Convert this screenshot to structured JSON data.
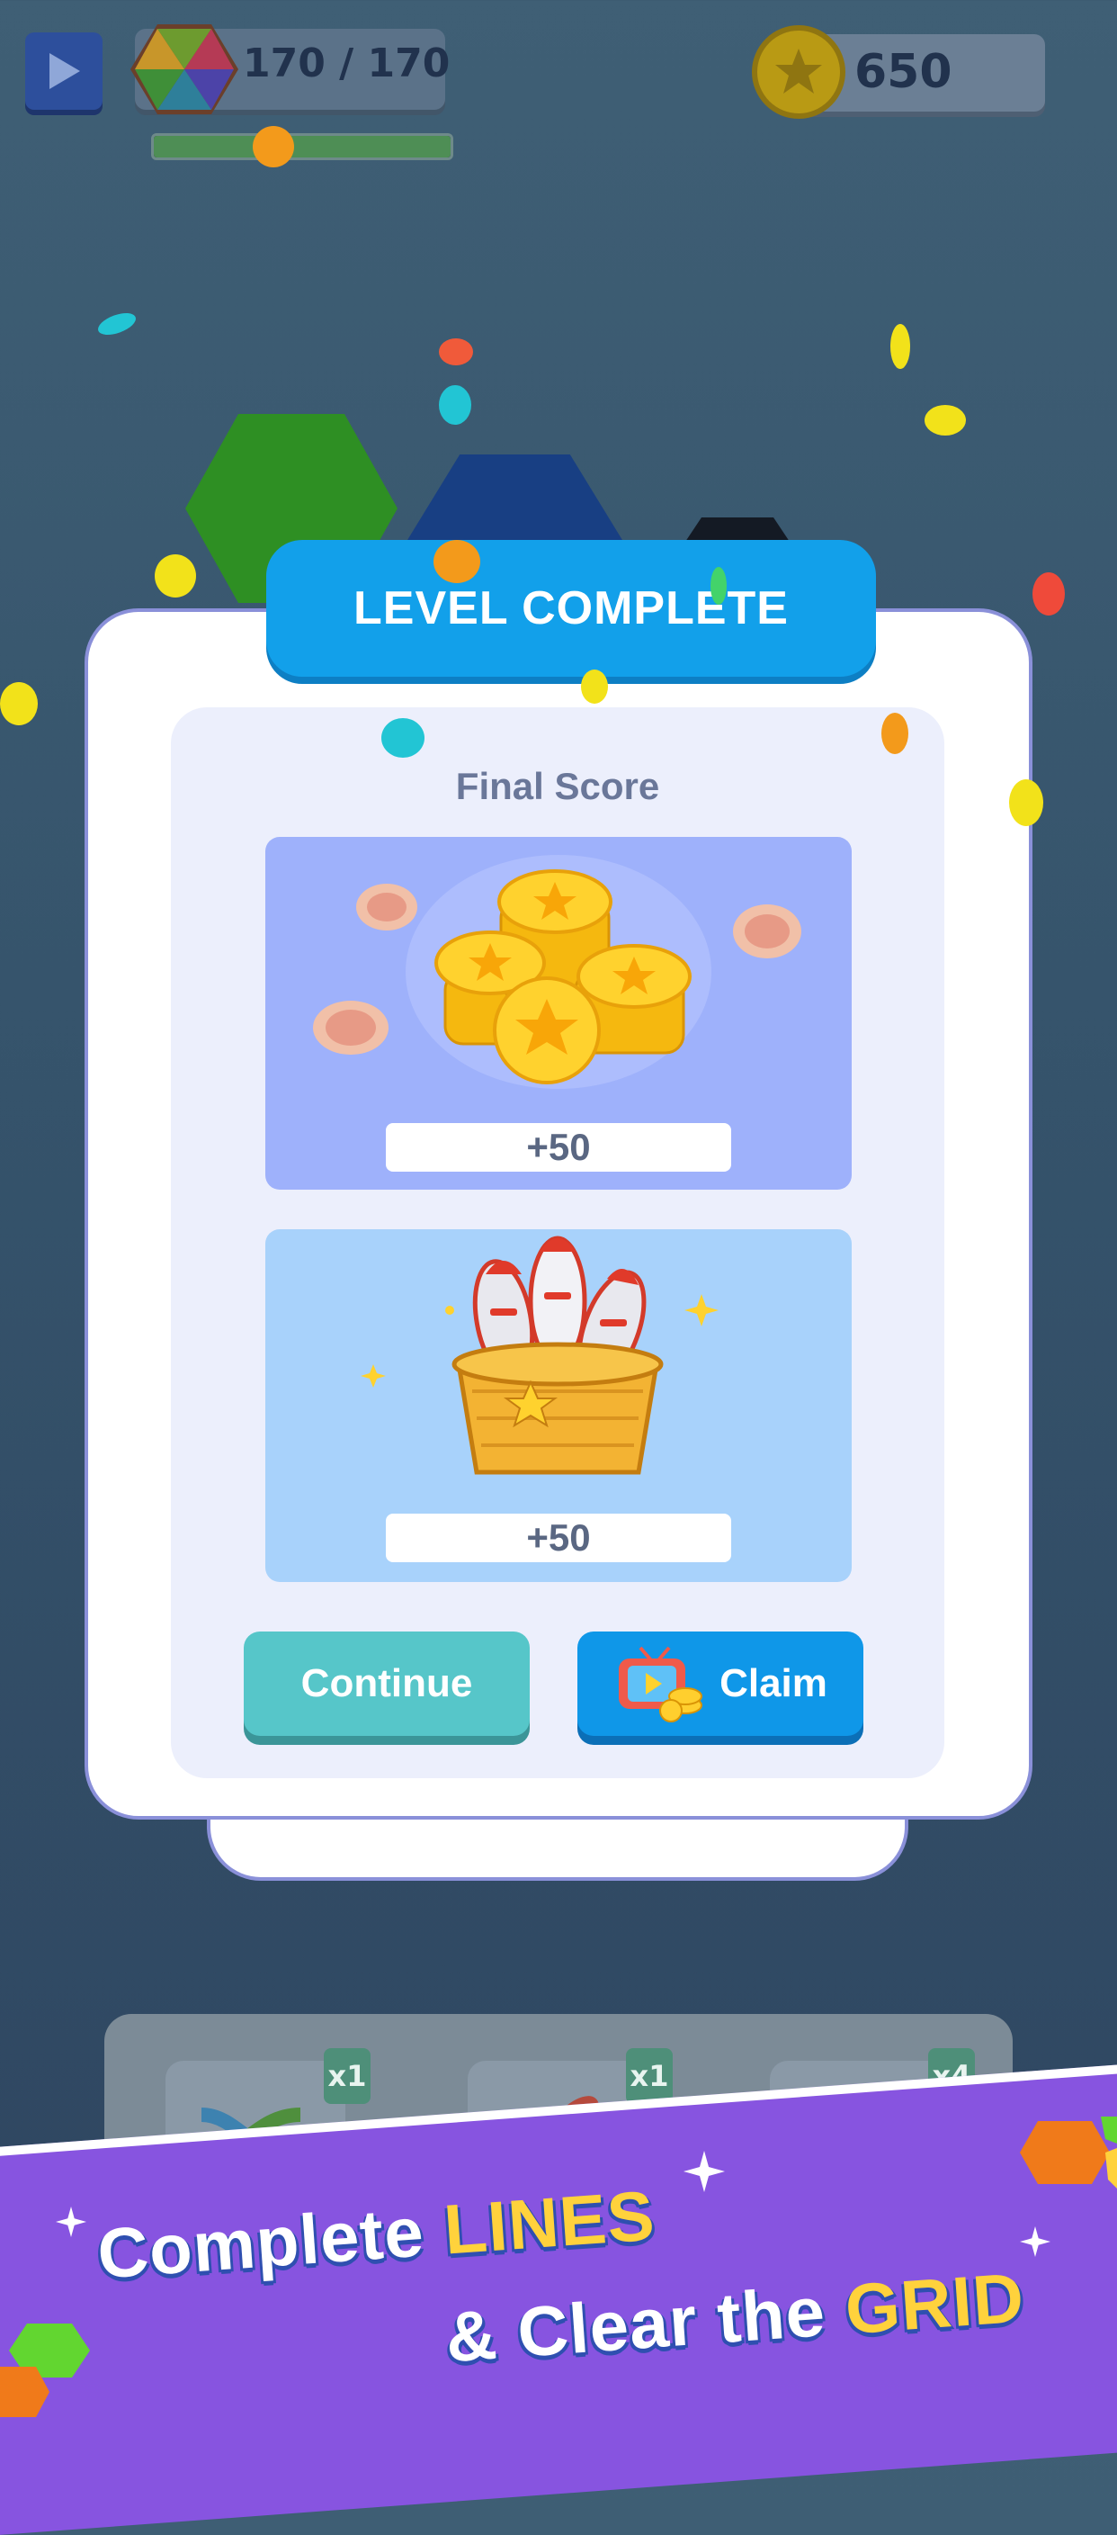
{
  "hud": {
    "play_icon": "play-icon",
    "hex_progress_text": "170 / 170",
    "progress_fraction": 1.0,
    "coins": "650"
  },
  "dialog": {
    "title": "LEVEL COMPLETE",
    "subtitle": "Final Score",
    "rewards": [
      {
        "icon": "coin-pile-icon",
        "amount": "+50"
      },
      {
        "icon": "rocket-basket-icon",
        "amount": "+50"
      }
    ],
    "continue_label": "Continue",
    "claim_label": "Claim",
    "claim_icon": "tv-ad-icon"
  },
  "boosters": [
    {
      "icon": "shuffle-icon",
      "count": "x1"
    },
    {
      "icon": "rocket-icon",
      "count": "x1"
    },
    {
      "icon": "triple-rocket-icon",
      "count": "x4"
    }
  ],
  "promo": {
    "line1_a": "Complete",
    "line1_b": "LINES",
    "line2_a": "& Clear the",
    "line2_b": "GRID"
  },
  "colors": {
    "accent_blue": "#12a0ea",
    "continue_teal": "#56c6c9",
    "promo_purple": "#8754e0",
    "highlight_yellow": "#ffd23c"
  }
}
